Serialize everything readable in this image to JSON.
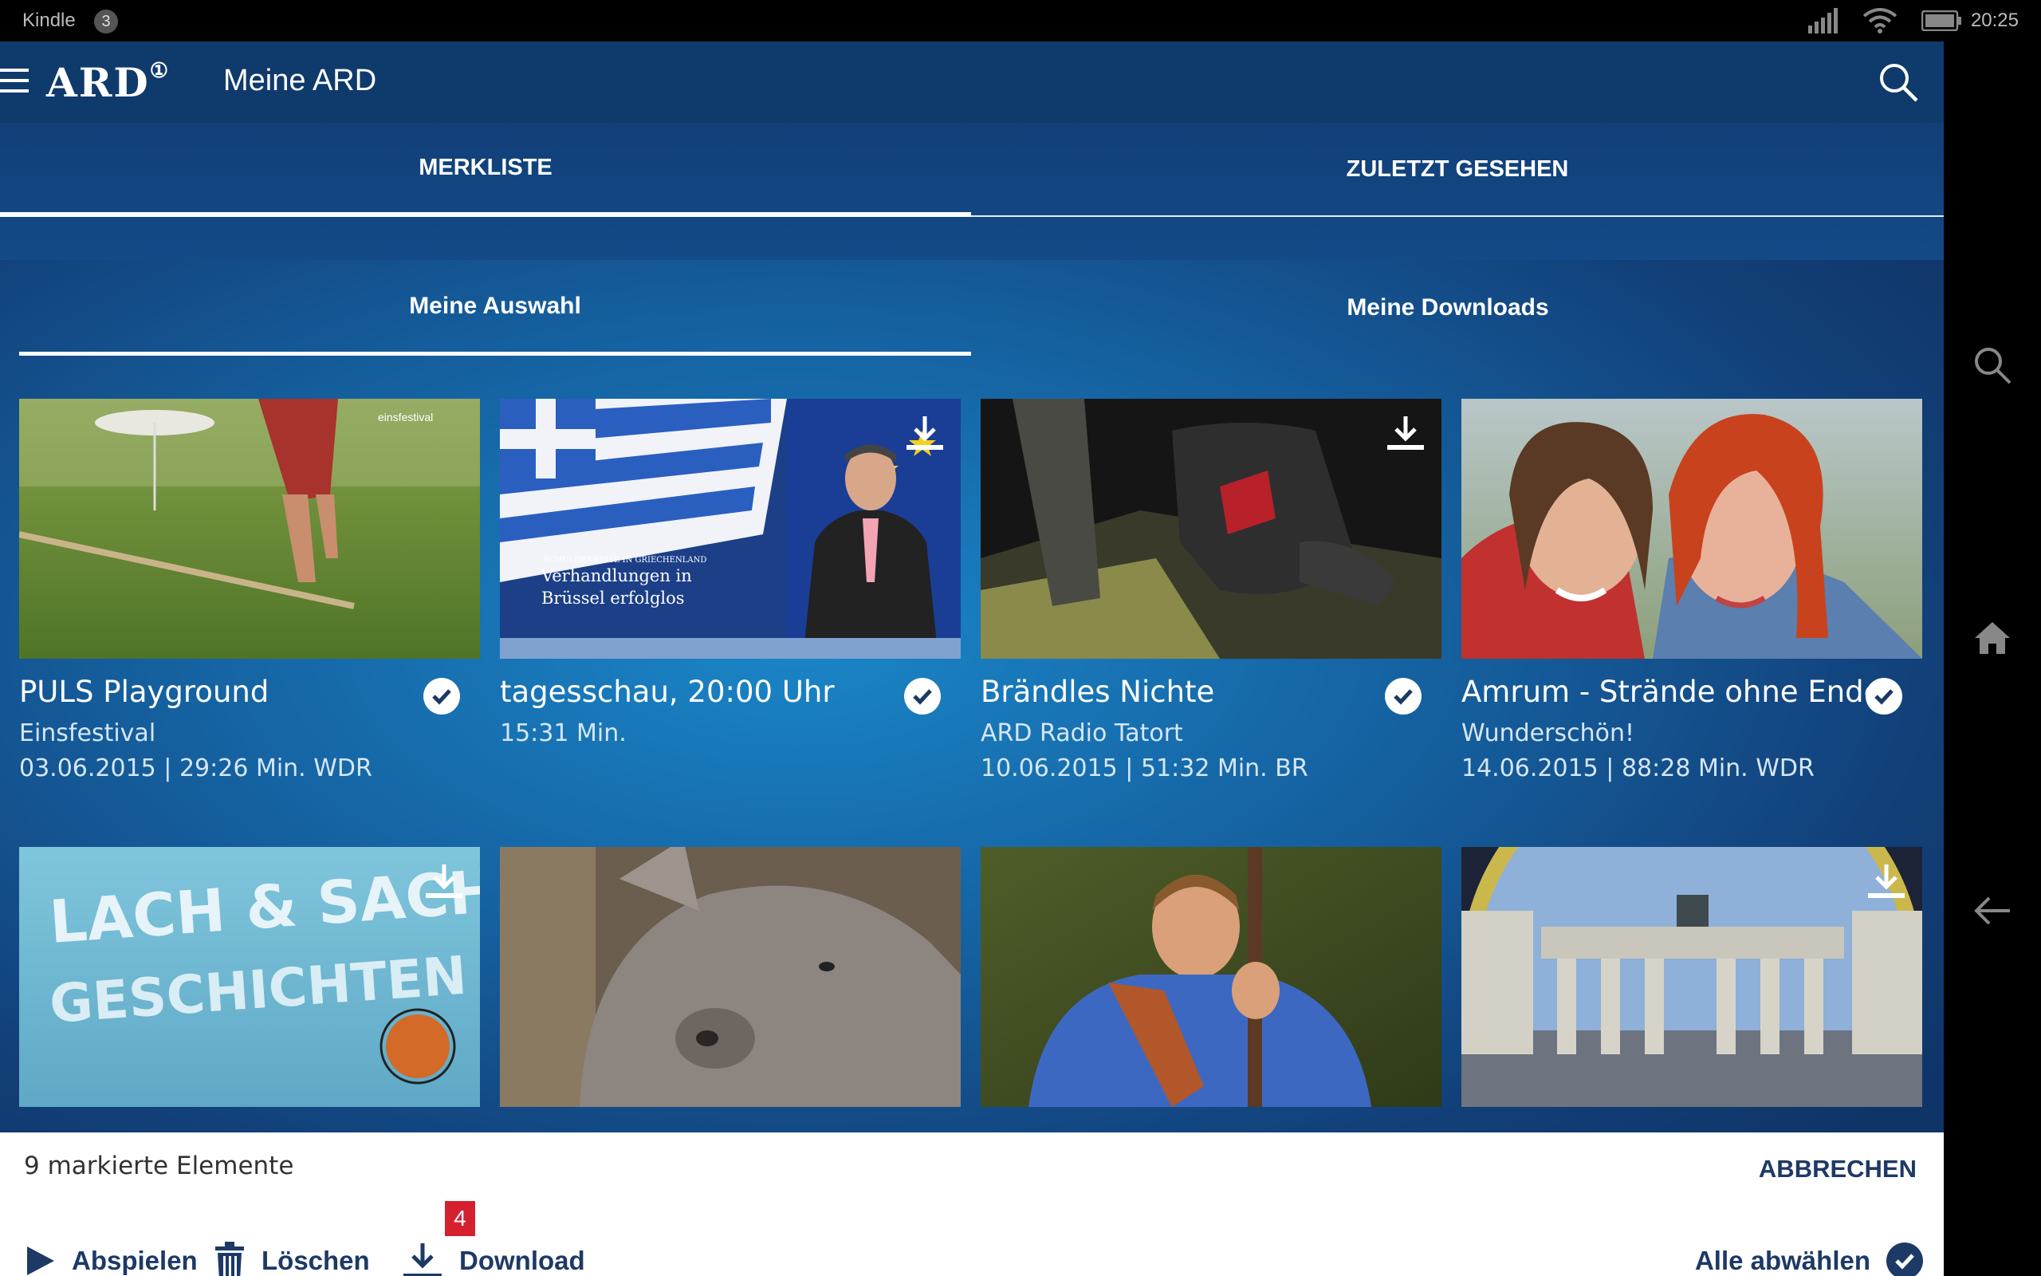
{
  "status_bar": {
    "app_name": "Kindle",
    "notification_count": "3",
    "time": "20:25"
  },
  "app_bar": {
    "logo": "ARD",
    "title": "Meine ARD"
  },
  "tabs": [
    {
      "label": "MERKLISTE"
    },
    {
      "label": "ZULETZT GESEHEN"
    }
  ],
  "subtabs": [
    {
      "label": "Meine Auswahl"
    },
    {
      "label": "Meine Downloads"
    }
  ],
  "cards": [
    {
      "title": "PULS Playground",
      "line1": "Einsfestival",
      "line2": "03.06.2015 | 29:26 Min. WDR",
      "download_icon": false,
      "thumb_logo": "einsfestival",
      "selected": true
    },
    {
      "title": "tagesschau, 20:00 Uhr",
      "line1": "15:31 Min.",
      "line2": "",
      "download_icon": true,
      "thumb_caption_small": "SCHULDENKRISE IN GRIECHENLAND",
      "thumb_caption": "Verhandlungen in Brüssel erfolglos",
      "selected": true
    },
    {
      "title": "Brändles Nichte",
      "line1": "ARD Radio Tatort",
      "line2": "10.06.2015 | 51:32 Min. BR",
      "download_icon": true,
      "selected": true
    },
    {
      "title": "Amrum - Strände ohne Ende",
      "line1": "Wunderschön!",
      "line2": "14.06.2015 | 88:28 Min. WDR",
      "download_icon": false,
      "selected": true
    },
    {
      "title": "",
      "line1": "",
      "line2": "",
      "download_icon": true,
      "thumb_text_1": "LACH & SACH-",
      "thumb_text_2": "GESCHICHTEN"
    },
    {
      "title": "",
      "line1": "",
      "line2": "",
      "download_icon": false
    },
    {
      "title": "",
      "line1": "",
      "line2": "",
      "download_icon": false
    },
    {
      "title": "",
      "line1": "",
      "line2": "",
      "download_icon": true
    }
  ],
  "action_sheet": {
    "selected_count_text": "9 markierte Elemente",
    "cancel_label": "ABBRECHEN",
    "play_label": "Abspielen",
    "delete_label": "Löschen",
    "download_label": "Download",
    "download_badge": "4",
    "deselect_all_label": "Alle abwählen"
  },
  "colors": {
    "app_bar": "#0f3a6c",
    "accent_dark": "#1d3966",
    "badge_red": "#d5202f",
    "background_blue": "#1a86c8"
  }
}
